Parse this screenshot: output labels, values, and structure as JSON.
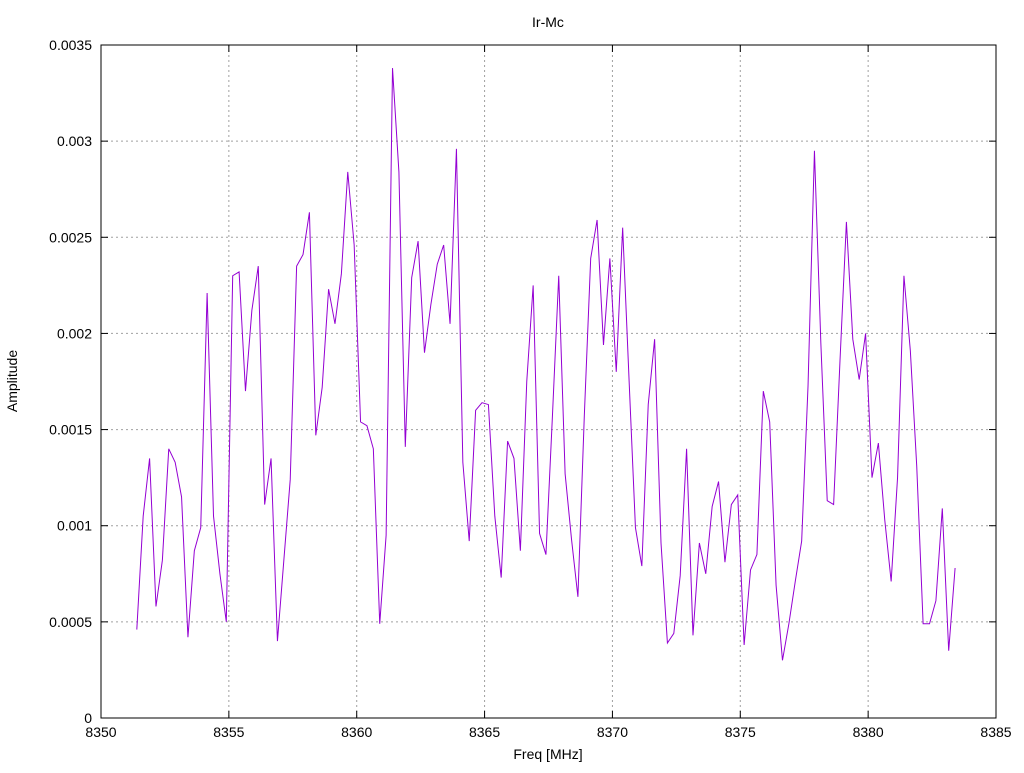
{
  "colors": {
    "series": "#9400d3",
    "grid": "#a0a0a0",
    "axis": "#000000",
    "background": "#ffffff"
  },
  "chart_data": {
    "type": "line",
    "title": "Ir-Mc",
    "xlabel": "Freq [MHz]",
    "ylabel": "Amplitude",
    "xlim": [
      8350,
      8385
    ],
    "ylim": [
      0,
      0.0035
    ],
    "xticks": [
      8350,
      8355,
      8360,
      8365,
      8370,
      8375,
      8380,
      8385
    ],
    "xtick_labels": [
      "8350",
      "8355",
      "8360",
      "8365",
      "8370",
      "8375",
      "8380",
      "8385"
    ],
    "yticks": [
      0,
      0.0005,
      0.001,
      0.0015,
      0.002,
      0.0025,
      0.003,
      0.0035
    ],
    "ytick_labels": [
      "0",
      "0.0005",
      "0.001",
      "0.0015",
      "0.002",
      "0.0025",
      "0.003",
      "0.0035"
    ],
    "grid": true,
    "legend": "none",
    "series": [
      {
        "x": [
          8351.4,
          8351.65,
          8351.9,
          8352.15,
          8352.4,
          8352.65,
          8352.9,
          8353.15,
          8353.4,
          8353.65,
          8353.9,
          8354.15,
          8354.4,
          8354.65,
          8354.9,
          8355.15,
          8355.4,
          8355.65,
          8355.9,
          8356.15,
          8356.4,
          8356.65,
          8356.9,
          8357.15,
          8357.4,
          8357.65,
          8357.9,
          8358.15,
          8358.4,
          8358.65,
          8358.9,
          8359.15,
          8359.4,
          8359.65,
          8359.9,
          8360.15,
          8360.4,
          8360.65,
          8360.9,
          8361.15,
          8361.4,
          8361.65,
          8361.9,
          8362.15,
          8362.4,
          8362.65,
          8362.9,
          8363.15,
          8363.4,
          8363.65,
          8363.9,
          8364.15,
          8364.4,
          8364.65,
          8364.9,
          8365.15,
          8365.4,
          8365.65,
          8365.9,
          8366.15,
          8366.4,
          8366.65,
          8366.9,
          8367.15,
          8367.4,
          8367.65,
          8367.9,
          8368.15,
          8368.4,
          8368.65,
          8368.9,
          8369.15,
          8369.4,
          8369.65,
          8369.9,
          8370.15,
          8370.4,
          8370.65,
          8370.9,
          8371.15,
          8371.4,
          8371.65,
          8371.9,
          8372.15,
          8372.4,
          8372.65,
          8372.9,
          8373.15,
          8373.4,
          8373.65,
          8373.9,
          8374.15,
          8374.4,
          8374.65,
          8374.9,
          8375.15,
          8375.4,
          8375.65,
          8375.9,
          8376.15,
          8376.4,
          8376.65,
          8376.9,
          8377.15,
          8377.4,
          8377.65,
          8377.9,
          8378.15,
          8378.4,
          8378.65,
          8378.9,
          8379.15,
          8379.4,
          8379.65,
          8379.9,
          8380.15,
          8380.4,
          8380.65,
          8380.9,
          8381.15,
          8381.4,
          8381.65,
          8381.9,
          8382.15,
          8382.4,
          8382.65,
          8382.9,
          8383.15,
          8383.4
        ],
        "y": [
          0.00046,
          0.00105,
          0.00135,
          0.00058,
          0.00082,
          0.0014,
          0.00133,
          0.00115,
          0.00042,
          0.00087,
          0.00099,
          0.00221,
          0.00105,
          0.00075,
          0.0005,
          0.0023,
          0.00232,
          0.0017,
          0.00212,
          0.00235,
          0.00111,
          0.00135,
          0.0004,
          0.00082,
          0.00124,
          0.00235,
          0.00241,
          0.00263,
          0.00147,
          0.00172,
          0.00223,
          0.00205,
          0.00231,
          0.00284,
          0.00246,
          0.00154,
          0.00152,
          0.0014,
          0.00049,
          0.00095,
          0.00338,
          0.00284,
          0.00141,
          0.00229,
          0.00248,
          0.0019,
          0.00215,
          0.00236,
          0.00246,
          0.00205,
          0.00296,
          0.00133,
          0.00092,
          0.0016,
          0.00164,
          0.00163,
          0.00105,
          0.00073,
          0.00144,
          0.00135,
          0.00087,
          0.00175,
          0.00225,
          0.00096,
          0.00085,
          0.00156,
          0.0023,
          0.00127,
          0.00093,
          0.00063,
          0.00157,
          0.00239,
          0.00259,
          0.00194,
          0.00239,
          0.0018,
          0.00255,
          0.00176,
          0.00099,
          0.00079,
          0.00163,
          0.00197,
          0.00091,
          0.00039,
          0.00044,
          0.00074,
          0.0014,
          0.00043,
          0.00091,
          0.00075,
          0.0011,
          0.00123,
          0.00081,
          0.00111,
          0.00116,
          0.00038,
          0.00077,
          0.00085,
          0.0017,
          0.00154,
          0.00069,
          0.0003,
          0.00049,
          0.00071,
          0.00092,
          0.00173,
          0.00295,
          0.00195,
          0.00113,
          0.00111,
          0.00186,
          0.00258,
          0.00197,
          0.00176,
          0.002,
          0.00125,
          0.00143,
          0.00103,
          0.00071,
          0.00125,
          0.0023,
          0.00191,
          0.00131,
          0.00049,
          0.00049,
          0.00061,
          0.00109,
          0.00035,
          0.00078
        ]
      }
    ]
  }
}
